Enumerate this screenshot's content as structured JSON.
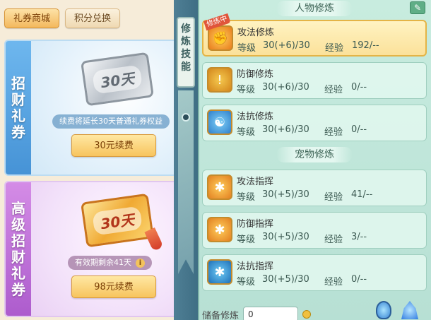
{
  "tabs": [
    {
      "label": "礼券商城",
      "active": true
    },
    {
      "label": "积分兑换",
      "active": false
    }
  ],
  "cards": [
    {
      "side_chars": [
        "招",
        "财",
        "礼",
        "券"
      ],
      "ticket_text": "30天",
      "desc": "续费将延长30天普通礼券权益",
      "button": "30元续费"
    },
    {
      "side_chars": [
        "高",
        "级",
        "招",
        "财",
        "礼",
        "券"
      ],
      "ticket_text": "30天",
      "desc": "有效期剩余41天",
      "button": "98元续费"
    }
  ],
  "banner_chars": [
    "修",
    "炼",
    "技",
    "能"
  ],
  "sections": {
    "character": "人物修炼",
    "pet": "宠物修炼"
  },
  "training": [
    {
      "title": "攻法修炼",
      "level_label": "等级",
      "level": "30(+6)/30",
      "exp_label": "经验",
      "exp": "192/--",
      "icon": "fire-claw-icon",
      "selected": true,
      "badge": "修炼中"
    },
    {
      "title": "防御修炼",
      "level_label": "等级",
      "level": "30(+6)/30",
      "exp_label": "经验",
      "exp": "0/--",
      "icon": "shield-icon"
    },
    {
      "title": "法抗修炼",
      "level_label": "等级",
      "level": "30(+6)/30",
      "exp_label": "经验",
      "exp": "0/--",
      "icon": "yin-yang-shield-icon"
    },
    {
      "title": "攻法指挥",
      "level_label": "等级",
      "level": "30(+5)/30",
      "exp_label": "经验",
      "exp": "41/--",
      "icon": "paw-attack-icon"
    },
    {
      "title": "防御指挥",
      "level_label": "等级",
      "level": "30(+5)/30",
      "exp_label": "经验",
      "exp": "3/--",
      "icon": "paw-defense-icon"
    },
    {
      "title": "法抗指挥",
      "level_label": "等级",
      "level": "30(+5)/30",
      "exp_label": "经验",
      "exp": "0/--",
      "icon": "paw-resist-icon"
    }
  ],
  "footer": {
    "label": "储备修炼",
    "value": "0"
  }
}
